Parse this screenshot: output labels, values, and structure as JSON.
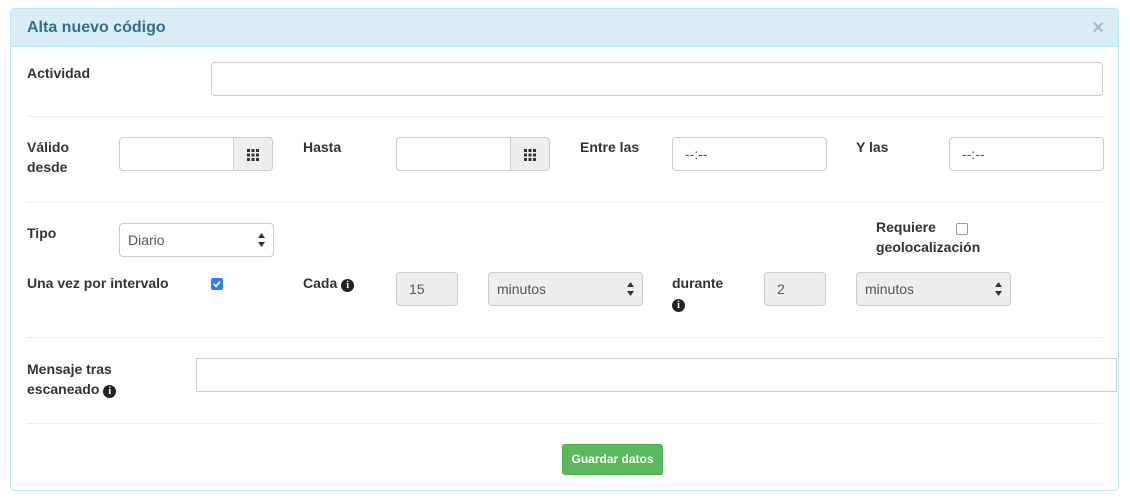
{
  "modal": {
    "title": "Alta nuevo código",
    "close_label": "×"
  },
  "form": {
    "actividad": {
      "label": "Actividad",
      "value": ""
    },
    "valido_desde": {
      "label_line1": "Válido",
      "label_line2": "desde",
      "value": ""
    },
    "hasta": {
      "label": "Hasta",
      "value": ""
    },
    "entre_las": {
      "label": "Entre las",
      "value": "--:--"
    },
    "y_las": {
      "label": "Y las",
      "value": "--:--"
    },
    "tipo": {
      "label": "Tipo",
      "value": "Diario"
    },
    "requiere_geo": {
      "label_line1": "Requiere",
      "label_line2": "geolocalización",
      "checked": false
    },
    "una_vez": {
      "label": "Una vez por intervalo",
      "checked": true
    },
    "cada": {
      "label": "Cada",
      "value": "15",
      "unit": "minutos"
    },
    "durante": {
      "label": "durante",
      "value": "2",
      "unit": "minutos"
    },
    "mensaje": {
      "label_line1": "Mensaje tras",
      "label_line2": "escaneado",
      "value": ""
    },
    "save_label": "Guardar datos"
  },
  "colors": {
    "heading_bg": "#d9edf7",
    "heading_text": "#31708f",
    "button_bg": "#5cb85c",
    "checkbox_checked": "#2f80ed"
  },
  "icons": {
    "calendar": "calendar-grid-icon",
    "info": "info-icon",
    "close": "close-icon",
    "select": "select-arrows-icon"
  }
}
